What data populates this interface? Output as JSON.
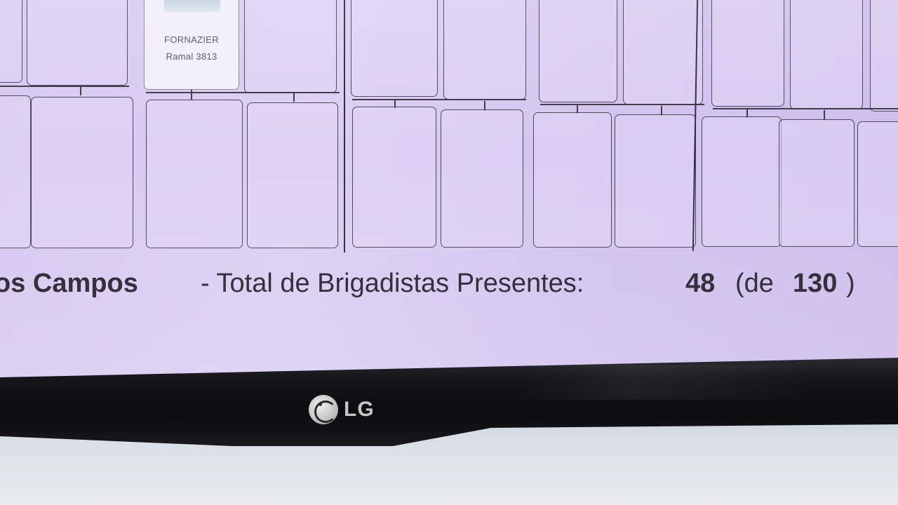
{
  "photo_card": {
    "name": "FORNAZIER",
    "extension": "Ramal 3813"
  },
  "summary": {
    "location_fragment": "os Campos",
    "label": "- Total de Brigadistas Presentes:",
    "present": "48",
    "of_open": "(de",
    "total": "130",
    "close": ")"
  },
  "monitor": {
    "brand": "LG"
  },
  "colors": {
    "screen_background": "#d6c8ef",
    "card_border": "#4a4458",
    "bezel": "#16161a"
  },
  "icons": {
    "logo": "lg-logo-icon"
  }
}
